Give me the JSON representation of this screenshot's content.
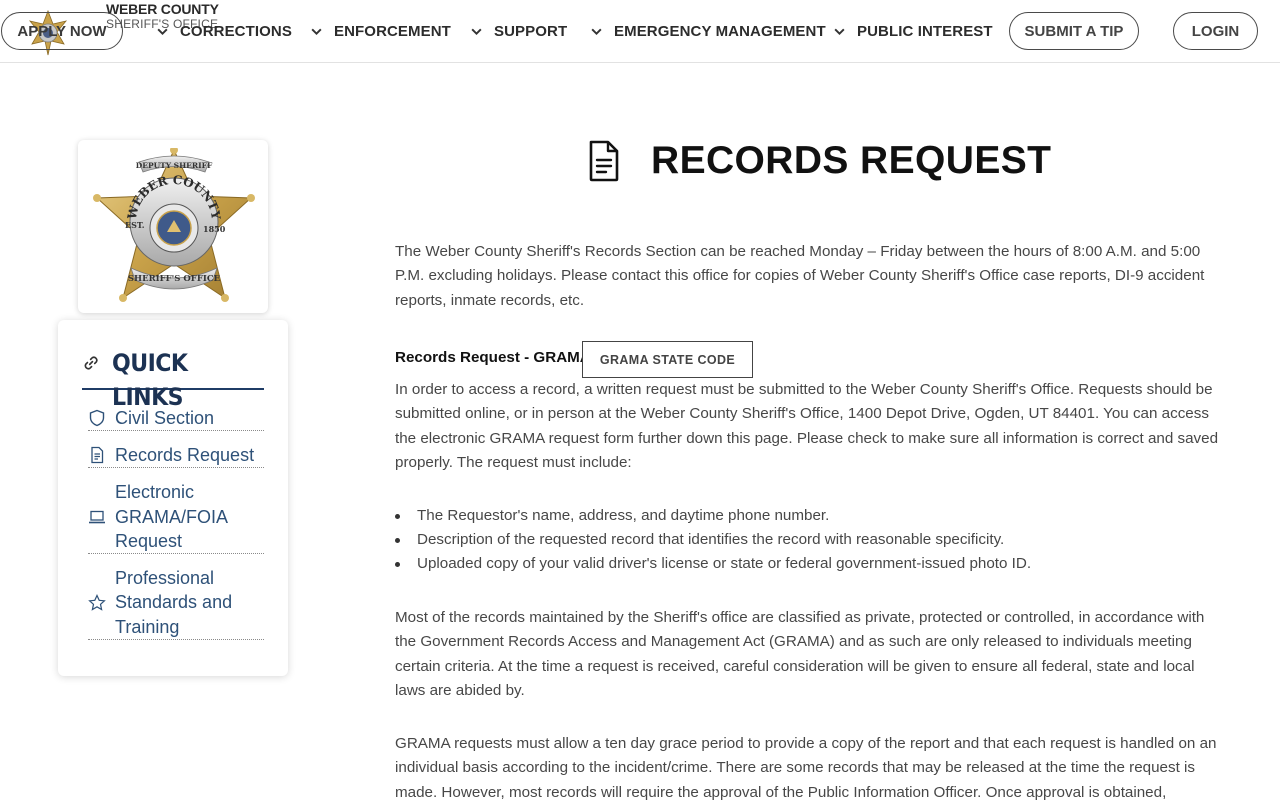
{
  "header": {
    "brand_line1": "WEBER COUNTY",
    "brand_line2": "SHERIFF'S OFFICE",
    "apply_now": "APPLY NOW",
    "nav": [
      "CORRECTIONS",
      "ENFORCEMENT",
      "SUPPORT",
      "EMERGENCY MANAGEMENT",
      "PUBLIC INTEREST"
    ],
    "submit_tip": "SUBMIT A TIP",
    "login": "LOGIN"
  },
  "sidebar": {
    "quick_links_title": "QUICK LINKS",
    "links": [
      {
        "label": "Civil Section",
        "icon": "shield-icon"
      },
      {
        "label": "Records Request",
        "icon": "document-icon"
      },
      {
        "label": "Electronic GRAMA/FOIA Request",
        "icon": "laptop-icon"
      },
      {
        "label": "Professional Standards and Training",
        "icon": "star-icon"
      }
    ]
  },
  "main": {
    "title": "RECORDS REQUEST",
    "intro": "The Weber County Sheriff's Records Section can be reached Monday – Friday between the hours of 8:00 A.M. and 5:00 P.M. excluding holidays. Please contact this office for copies of Weber County Sheriff's Office case reports, DI-9 accident reports, inmate records, etc.",
    "grama_label": "Records Request - GRAMA",
    "grama_button": "GRAMA STATE CODE",
    "grama_text": "In order to access a record, a written request must be submitted to the Weber County Sheriff's Office. Requests should be submitted online, or in person at the Weber County Sheriff's Office, 1400 Depot Drive, Ogden, UT 84401. You can access the electronic GRAMA request form further down this page. Please check to make sure all information is correct and saved properly. The request must include:",
    "requirements": [
      "The Requestor's name, address, and daytime phone number.",
      "Description of the requested record that identifies the record with reasonable specificity.",
      "Uploaded copy of your valid driver's license or state or federal government-issued photo ID."
    ],
    "classification_text": "Most of the records maintained by the Sheriff's office are classified as private, protected or controlled, in accordance with the Government Records Access and Management Act (GRAMA) and as such are only released to individuals meeting certain criteria. At the time a request is received, careful consideration will be given to ensure all federal, state and local laws are abided by.",
    "grace_text": "GRAMA requests must allow a ten day grace period to provide a copy of the report and that each request is handled on an individual basis according to the incident/crime. There are some records that may be released at the time the request is made. However, most records will require the approval of the Public Information Officer. Once approval is obtained,"
  },
  "badge": {
    "top_ribbon": "DEPUTY SHERIFF",
    "arc_text": "WEBER COUNTY",
    "est": "EST.",
    "year": "1850",
    "bottom_ribbon": "SHERIFF'S OFFICE"
  },
  "colors": {
    "accent_navy": "#1c3253",
    "link_blue": "#2e5178",
    "badge_gold": "#c9a24a"
  }
}
